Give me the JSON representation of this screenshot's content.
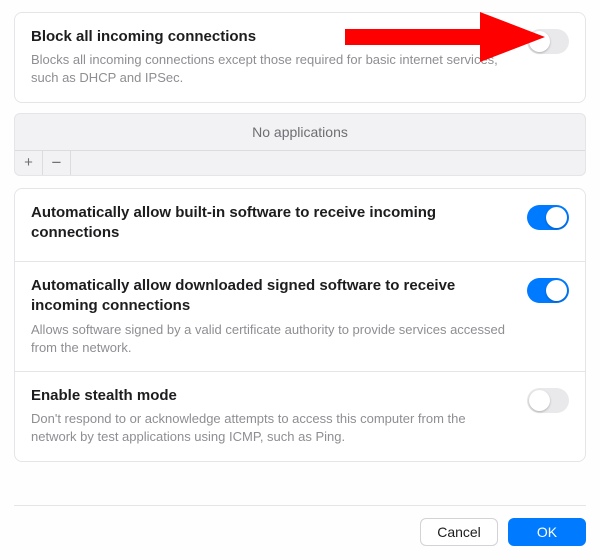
{
  "sections": {
    "block_all": {
      "title": "Block all incoming connections",
      "desc": "Blocks all incoming connections except those required for basic internet services, such as DHCP and IPSec.",
      "on": false
    },
    "apps": {
      "empty_label": "No applications",
      "add_label": "+",
      "remove_label": "−"
    },
    "auto_builtin": {
      "title": "Automatically allow built-in software to receive incoming connections",
      "on": true
    },
    "auto_signed": {
      "title": "Automatically allow downloaded signed software to receive incoming connections",
      "desc": "Allows software signed by a valid certificate authority to provide services accessed from the network.",
      "on": true
    },
    "stealth": {
      "title": "Enable stealth mode",
      "desc": "Don't respond to or acknowledge attempts to access this computer from the network by test applications using ICMP, such as Ping.",
      "on": false
    }
  },
  "buttons": {
    "cancel": "Cancel",
    "ok": "OK"
  },
  "colors": {
    "accent": "#007aff",
    "annotation": "#ff0000"
  }
}
